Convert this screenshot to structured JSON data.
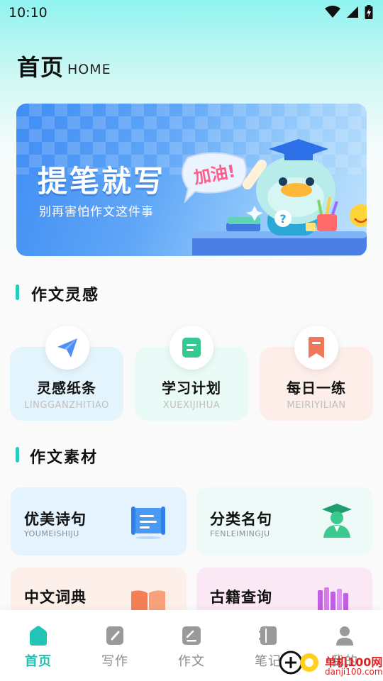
{
  "status_bar": {
    "time": "10:10",
    "icons": [
      "wifi-icon",
      "cellular-signal-icon",
      "battery-charging-icon"
    ]
  },
  "header": {
    "title": "首页",
    "subtitle": "HOME"
  },
  "banner": {
    "title": "提笔就写",
    "subtitle": "别再害怕作文这件事",
    "bubble_text": "加油!"
  },
  "inspiration": {
    "section_title": "作文灵感",
    "cards": [
      {
        "label": "灵感纸条",
        "pinyin": "LINGGANZHITIAO",
        "icon": "paper-plane-icon",
        "bg": "#e3f4fd",
        "accent": "#4f8ef7"
      },
      {
        "label": "学习计划",
        "pinyin": "XUEXIJIHUA",
        "icon": "plan-note-icon",
        "bg": "#e9faf7",
        "accent": "#34c98e"
      },
      {
        "label": "每日一练",
        "pinyin": "MEIRIYILIAN",
        "icon": "bookmark-icon",
        "bg": "#fdeee9",
        "accent": "#f0785a"
      }
    ]
  },
  "materials": {
    "section_title": "作文素材",
    "cards": [
      {
        "title": "优美诗句",
        "pinyin": "YOUMEISHIJU",
        "icon": "scroll-icon",
        "bg": "#e4f3fd"
      },
      {
        "title": "分类名句",
        "pinyin": "FENLEIMINGJU",
        "icon": "graduate-icon",
        "bg": "#eefaf8"
      },
      {
        "title": "中文词典",
        "pinyin": "",
        "icon": "open-book-icon",
        "bg": "#fdf0ea"
      },
      {
        "title": "古籍查询",
        "pinyin": "",
        "icon": "bookshelf-icon",
        "bg": "#fbe8f5"
      }
    ]
  },
  "tab_bar": {
    "tabs": [
      {
        "label": "首页",
        "icon": "home-icon",
        "active": true
      },
      {
        "label": "写作",
        "icon": "write-icon",
        "active": false
      },
      {
        "label": "作文",
        "icon": "essay-icon",
        "active": false
      },
      {
        "label": "笔记",
        "icon": "notebook-icon",
        "active": false
      },
      {
        "label": "我的",
        "icon": "profile-icon",
        "active": false
      }
    ]
  },
  "watermark": {
    "text": "单机100网",
    "url": "danji100.com"
  },
  "colors": {
    "accent": "#1fbfb2",
    "section_bar": "#26cdbf"
  }
}
